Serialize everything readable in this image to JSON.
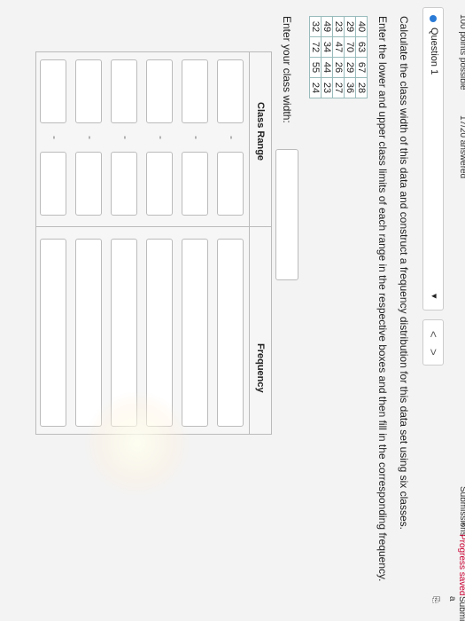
{
  "top": {
    "points": "100 points possible",
    "answered": "17/20 answered",
    "submissions": "Submissions",
    "close": "×",
    "progress": "Progress saved",
    "submit": "Submit a"
  },
  "question": {
    "label": "Question 1",
    "caret": "▾",
    "prev": "<",
    "next": ">",
    "instructions1": "Calculate the class width of this data and construct a frequency distribution for this data set using six classes.",
    "instructions2": "Enter the lower and upper class limits of each range in the respective boxes and then fill in the corresponding frequency.",
    "data": [
      [
        "40",
        "63",
        "67",
        "28"
      ],
      [
        "29",
        "70",
        "29",
        "36"
      ],
      [
        "23",
        "47",
        "26",
        "27"
      ],
      [
        "49",
        "34",
        "44",
        "23"
      ],
      [
        "32",
        "72",
        "55",
        "24"
      ]
    ],
    "class_width_label": "Enter your class width:",
    "class_width_value": ""
  },
  "freq_table": {
    "header_class": "Class Range",
    "header_freq": "Frequency",
    "dash": "-",
    "rows": 6
  }
}
